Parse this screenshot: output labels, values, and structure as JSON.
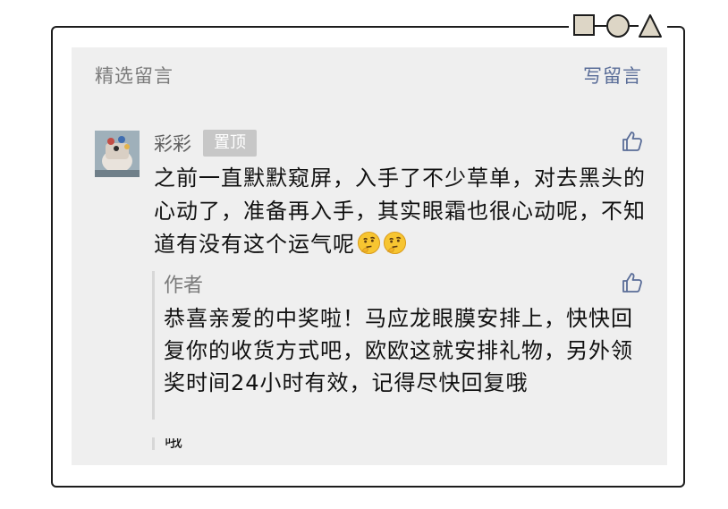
{
  "header": {
    "title": "精选留言",
    "action": "写留言"
  },
  "comment": {
    "username": "彩彩",
    "badge": "置顶",
    "text": "之前一直默默窥屏，入手了不少草单，对去黑头的心动了，准备再入手，其实眼霜也很心动呢，不知道有没有这个运气呢",
    "emoji_icons": [
      "thinking-face-icon",
      "thinking-face-icon"
    ]
  },
  "reply": {
    "author": "作者",
    "text": "恭喜亲爱的中奖啦！马应龙眼膜安排上，快快回复你的收货方式吧，欧欧这就安排礼物，另外领奖时间24小时有效，记得尽快回复哦",
    "cutoff_text": "哦"
  },
  "colors": {
    "action_link": "#5a6d98",
    "muted_text": "#7b7b7b",
    "panel_bg": "#efefef",
    "badge_bg": "#c7c7c7",
    "shape_fill": "#ddd6c6"
  },
  "icons": [
    "square-shape-icon",
    "circle-shape-icon",
    "triangle-shape-icon",
    "thumbs-up-icon"
  ]
}
